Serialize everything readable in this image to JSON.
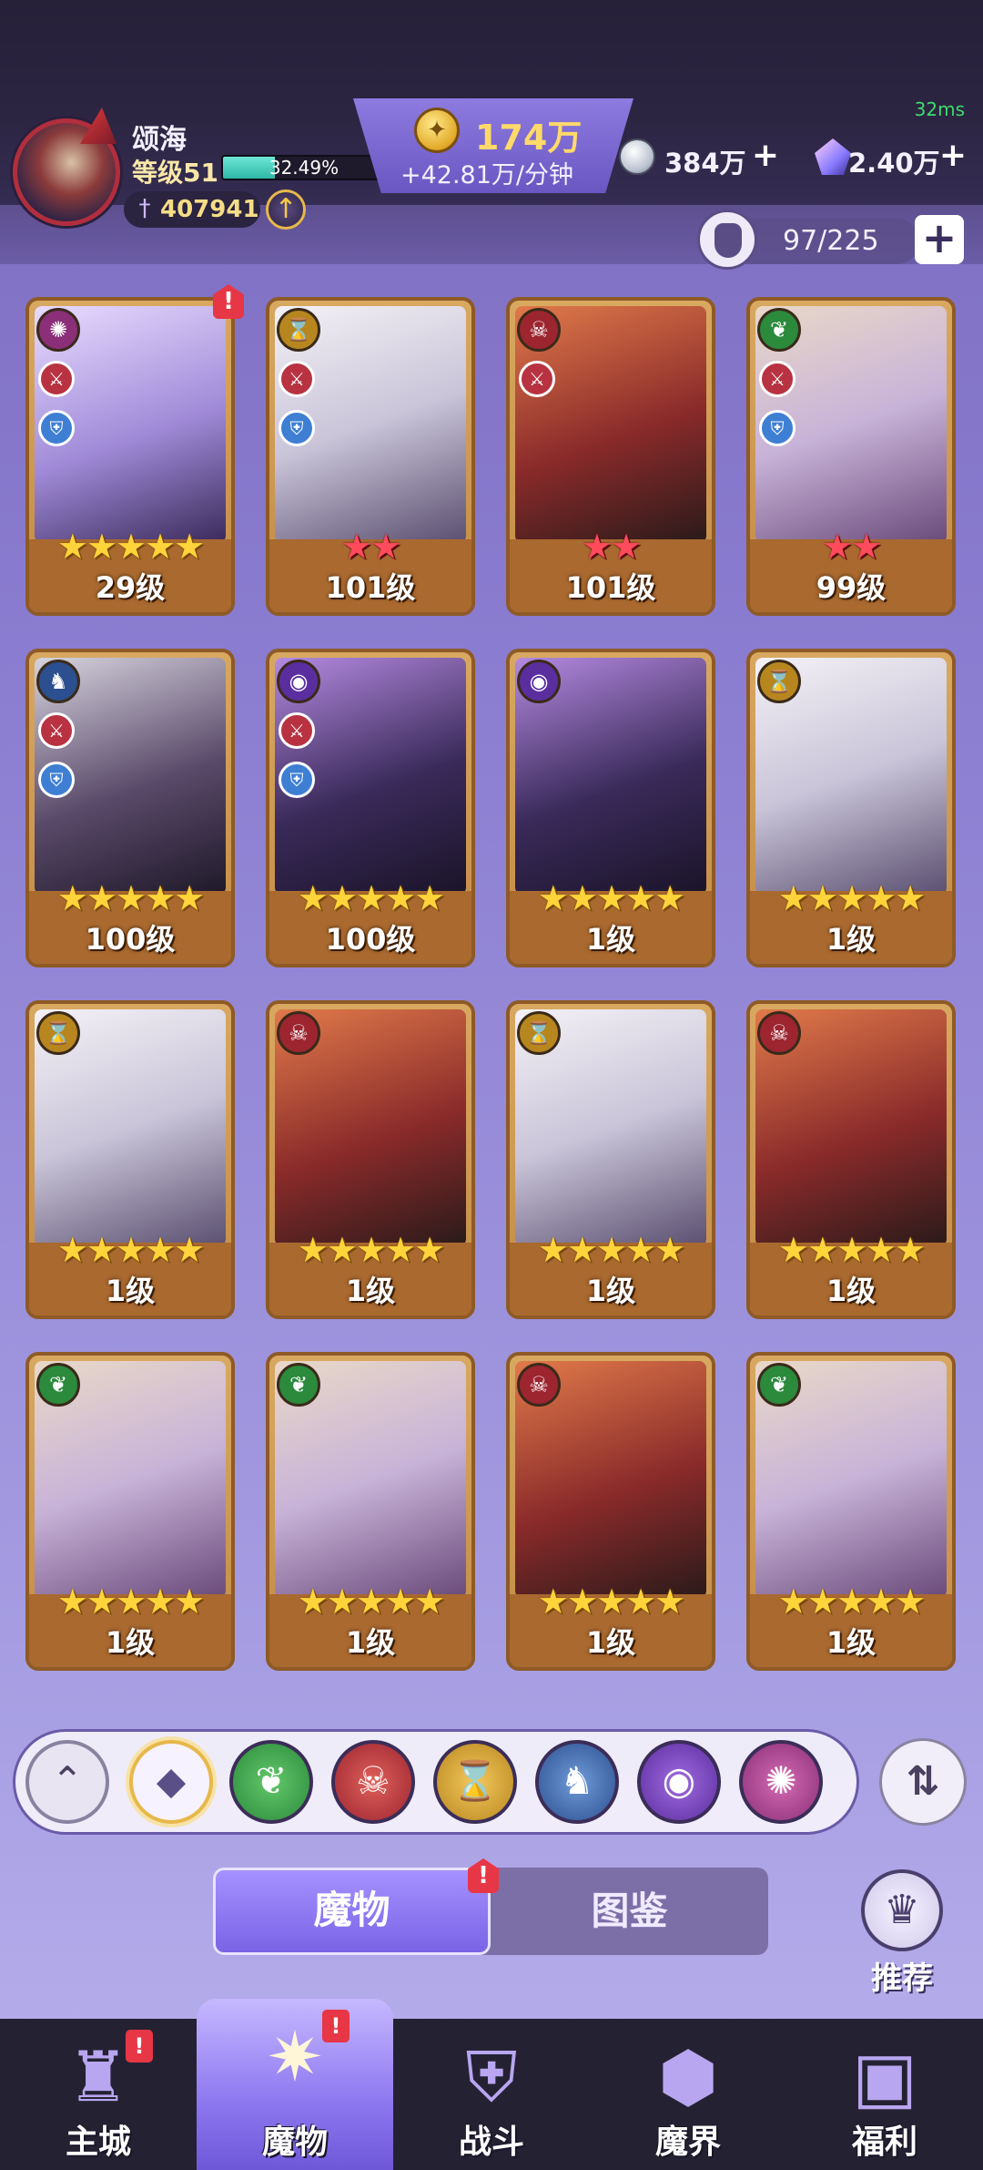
{
  "header": {
    "ping": "32ms",
    "player_name": "颂海",
    "player_level": "等级51",
    "exp_percent_text": "32.49%",
    "exp_fraction": 0.3249,
    "power": "407941",
    "gold_amount": "174万",
    "gold_rate": "+42.81万/分钟",
    "silver_amount": "384万",
    "gem_amount": "2.40万",
    "bag_count": "97/225"
  },
  "monsters": [
    {
      "faction": "void",
      "level": "29级",
      "stars": 5,
      "star_color": "gold",
      "roles": [
        "attack",
        "defense"
      ],
      "alert": true
    },
    {
      "faction": "time",
      "level": "101级",
      "stars": 2,
      "star_color": "red",
      "roles": [
        "attack",
        "defense"
      ],
      "alert": false
    },
    {
      "faction": "chaos",
      "level": "101级",
      "stars": 2,
      "star_color": "red",
      "roles": [
        "attack"
      ],
      "alert": false
    },
    {
      "faction": "nature",
      "level": "99级",
      "stars": 2,
      "star_color": "red",
      "roles": [
        "attack",
        "defense"
      ],
      "alert": false
    },
    {
      "faction": "dragon",
      "level": "100级",
      "stars": 5,
      "star_color": "gold",
      "roles": [
        "attack",
        "defense"
      ],
      "alert": false
    },
    {
      "faction": "eye",
      "level": "100级",
      "stars": 5,
      "star_color": "gold",
      "roles": [
        "attack",
        "defense"
      ],
      "alert": false
    },
    {
      "faction": "eye",
      "level": "1级",
      "stars": 5,
      "star_color": "gold",
      "roles": [],
      "alert": false
    },
    {
      "faction": "time",
      "level": "1级",
      "stars": 5,
      "star_color": "gold",
      "roles": [],
      "alert": false
    },
    {
      "faction": "time",
      "level": "1级",
      "stars": 5,
      "star_color": "gold",
      "roles": [],
      "alert": false
    },
    {
      "faction": "chaos",
      "level": "1级",
      "stars": 5,
      "star_color": "gold",
      "roles": [],
      "alert": false
    },
    {
      "faction": "time",
      "level": "1级",
      "stars": 5,
      "star_color": "gold",
      "roles": [],
      "alert": false
    },
    {
      "faction": "chaos",
      "level": "1级",
      "stars": 5,
      "star_color": "gold",
      "roles": [],
      "alert": false
    },
    {
      "faction": "nature",
      "level": "1级",
      "stars": 5,
      "star_color": "gold",
      "roles": [],
      "alert": false
    },
    {
      "faction": "nature",
      "level": "1级",
      "stars": 5,
      "star_color": "gold",
      "roles": [],
      "alert": false
    },
    {
      "faction": "chaos",
      "level": "1级",
      "stars": 5,
      "star_color": "gold",
      "roles": [],
      "alert": false
    },
    {
      "faction": "nature",
      "level": "1级",
      "stars": 5,
      "star_color": "gold",
      "roles": [],
      "alert": false
    }
  ],
  "filters": [
    "all",
    "nature",
    "chaos",
    "time",
    "dragon",
    "eye",
    "void"
  ],
  "tabs": {
    "monsters": "魔物",
    "compendium": "图鉴"
  },
  "recommend_label": "推荐",
  "bottom_nav": [
    {
      "label": "主城",
      "icon": "castle-icon",
      "alert": true,
      "active": false
    },
    {
      "label": "魔物",
      "icon": "monster-flame-icon",
      "alert": true,
      "active": true
    },
    {
      "label": "战斗",
      "icon": "battle-shield-icon",
      "alert": false,
      "active": false
    },
    {
      "label": "魔界",
      "icon": "demon-realm-icon",
      "alert": false,
      "active": false
    },
    {
      "label": "福利",
      "icon": "treasure-chest-icon",
      "alert": false,
      "active": false
    }
  ],
  "colors": {
    "nature": "#2b8a3c",
    "chaos": "#9c2530",
    "time": "#b7861e",
    "dragon": "#2c4f8f",
    "eye": "#5b2ea0",
    "void": "#8a2f78",
    "accent": "#7a63e6"
  }
}
